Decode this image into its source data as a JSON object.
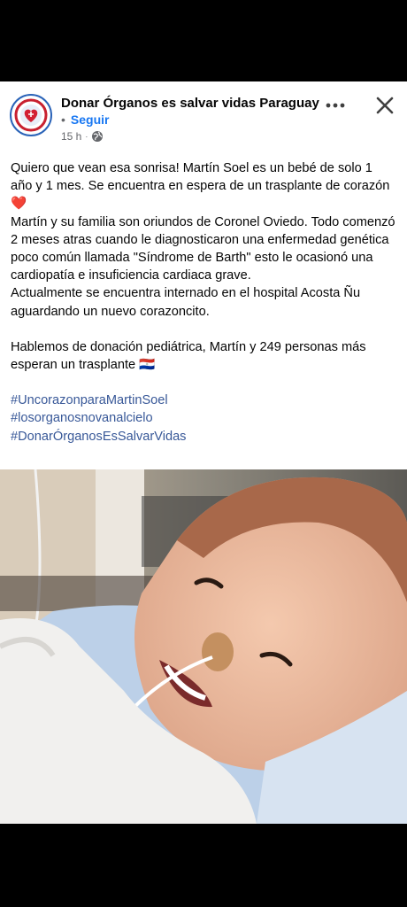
{
  "post": {
    "page_name": "Donar Órganos es salvar vidas Paraguay",
    "dot": "•",
    "follow_label": "Seguir",
    "time": "15 h",
    "more_label": "•••",
    "close_label": "✕",
    "paragraphs": [
      "Quiero que vean esa sonrisa! Martín Soel es un bebé de solo 1 año y 1 mes. Se encuentra en espera de un trasplante de corazón",
      "Martín y su familia son oriundos de Coronel Oviedo. Todo comenzó 2 meses atras cuando le diagnosticaron una enfermedad genética poco común llamada \"Síndrome de Barth\" esto le ocasionó una cardiopatía e insuficiencia cardiaca grave.",
      "Actualmente se encuentra internado en el hospital Acosta Ñu aguardando un nuevo corazoncito.",
      "Hablemos de donación pediátrica, Martín y 249 personas más esperan un trasplante"
    ],
    "heart_emoji": "❤️",
    "flag_emoji": "🇵🇾",
    "hashtags": [
      "#UncorazonparaMartinSoel",
      "#losorganosnovanalcielo",
      "#DonarÓrganosEsSalvarVidas"
    ]
  },
  "icons": {
    "avatar": "organ-donation-logo",
    "globe": "globe-icon",
    "more": "more-icon",
    "close": "close-icon"
  },
  "colors": {
    "link": "#1877f2",
    "hashtag": "#385898",
    "heart": "#e0245e"
  }
}
